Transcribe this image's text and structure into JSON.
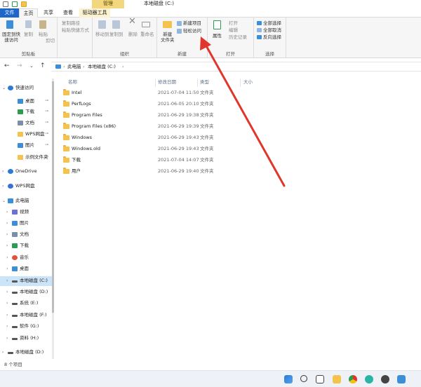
{
  "window": {
    "title": "本地磁盘 (C:)",
    "context_tab": "管理"
  },
  "tabs": [
    "文件",
    "主页",
    "共享",
    "查看",
    "驱动器工具"
  ],
  "ribbon": {
    "clipboard": {
      "pin": "固定到快\n速访问",
      "copy": "复制",
      "paste": "粘贴",
      "copy_path": "复制路径",
      "paste_shortcut": "粘贴快捷方式",
      "cut": "剪切",
      "label": "剪贴板"
    },
    "organize": {
      "move_to": "移动到",
      "copy_to": "复制到",
      "delete": "删除",
      "rename": "重命名",
      "label": "组织"
    },
    "new": {
      "new_folder": "新建\n文件夹",
      "new_item": "新建项目",
      "easy_access": "轻松访问",
      "label": "新建"
    },
    "open": {
      "properties": "属性",
      "open": "打开",
      "edit": "编辑",
      "history": "历史记录",
      "label": "打开"
    },
    "select": {
      "select_all": "全部选择",
      "select_none": "全部取消",
      "invert": "反向选择",
      "label": "选择"
    }
  },
  "address": {
    "crumbs": [
      "此电脑",
      "本地磁盘 (C:)"
    ]
  },
  "columns": {
    "name": "名称",
    "date": "修改日期",
    "type": "类型",
    "size": "大小"
  },
  "files": [
    {
      "name": "Intel",
      "date": "2021-07-04 11:50",
      "type": "文件夹"
    },
    {
      "name": "PerfLogs",
      "date": "2021-06-05 20:10",
      "type": "文件夹"
    },
    {
      "name": "Program Files",
      "date": "2021-06-29 19:38",
      "type": "文件夹"
    },
    {
      "name": "Program Files (x86)",
      "date": "2021-06-29 19:39",
      "type": "文件夹"
    },
    {
      "name": "Windows",
      "date": "2021-06-29 19:43",
      "type": "文件夹"
    },
    {
      "name": "Windows.old",
      "date": "2021-06-29 19:43",
      "type": "文件夹"
    },
    {
      "name": "下载",
      "date": "2021-07-04 14:07",
      "type": "文件夹"
    },
    {
      "name": "用户",
      "date": "2021-06-29 19:40",
      "type": "文件夹"
    }
  ],
  "sidebar": [
    {
      "label": "快速访问",
      "icon": "star-icon",
      "color": "#2b7bd6",
      "chev": "⌄",
      "x": 4
    },
    {
      "label": "桌面",
      "icon": "desktop-icon",
      "color": "#3a8fd8",
      "pin": true,
      "x": 18
    },
    {
      "label": "下载",
      "icon": "download-icon",
      "color": "#2a9d52",
      "pin": true,
      "x": 18
    },
    {
      "label": "文档",
      "icon": "document-icon",
      "color": "#7a8ea8",
      "pin": true,
      "x": 18
    },
    {
      "label": "WPS网盘",
      "icon": "folder-icon",
      "color": "#f5c24b",
      "pin": true,
      "x": 18
    },
    {
      "label": "图片",
      "icon": "picture-icon",
      "color": "#3a8fd8",
      "pin": true,
      "x": 18
    },
    {
      "label": "示例文件夹",
      "icon": "folder-icon",
      "color": "#f5c24b",
      "pin": true,
      "x": 18
    },
    {
      "label": "OneDrive",
      "icon": "cloud-icon",
      "color": "#2b7bd6",
      "chev": "›",
      "x": 4
    },
    {
      "label": "WPS网盘",
      "icon": "cloud-icon",
      "color": "#3a6ed8",
      "chev": "›",
      "x": 4
    },
    {
      "label": "此电脑",
      "icon": "computer-icon",
      "color": "#3a8fd8",
      "chev": "⌄",
      "x": 4
    },
    {
      "label": "视频",
      "icon": "video-icon",
      "color": "#6b6fd6",
      "chev": "›",
      "x": 10
    },
    {
      "label": "图片",
      "icon": "picture-icon",
      "color": "#3a8fd8",
      "chev": "›",
      "x": 10
    },
    {
      "label": "文档",
      "icon": "document-icon",
      "color": "#7a8ea8",
      "chev": "›",
      "x": 10
    },
    {
      "label": "下载",
      "icon": "download-icon",
      "color": "#2a9d52",
      "chev": "›",
      "x": 10
    },
    {
      "label": "音乐",
      "icon": "music-icon",
      "color": "#e0533a",
      "chev": "›",
      "x": 10
    },
    {
      "label": "桌面",
      "icon": "desktop-icon",
      "color": "#3a8fd8",
      "chev": "›",
      "x": 10
    },
    {
      "label": "本地磁盘 (C:)",
      "icon": "drive-icon",
      "color": "#555",
      "chev": "›",
      "x": 10,
      "sel": true
    },
    {
      "label": "本地磁盘 (D:)",
      "icon": "drive-icon",
      "color": "#555",
      "chev": "›",
      "x": 10
    },
    {
      "label": "系统 (E:)",
      "icon": "drive-icon",
      "color": "#555",
      "chev": "›",
      "x": 10
    },
    {
      "label": "本地磁盘 (F:)",
      "icon": "drive-icon",
      "color": "#555",
      "chev": "›",
      "x": 10
    },
    {
      "label": "软件 (G:)",
      "icon": "drive-icon",
      "color": "#555",
      "chev": "›",
      "x": 10
    },
    {
      "label": "资料 (H:)",
      "icon": "drive-icon",
      "color": "#555",
      "chev": "›",
      "x": 10
    },
    {
      "label": "本地磁盘 (D:)",
      "icon": "drive-icon",
      "color": "#555",
      "chev": "›",
      "x": 4
    }
  ],
  "status": "8 个项目",
  "colors": {
    "accent": "#1e66c9",
    "annotation": "#e0362c",
    "selection": "#cce4f7"
  }
}
